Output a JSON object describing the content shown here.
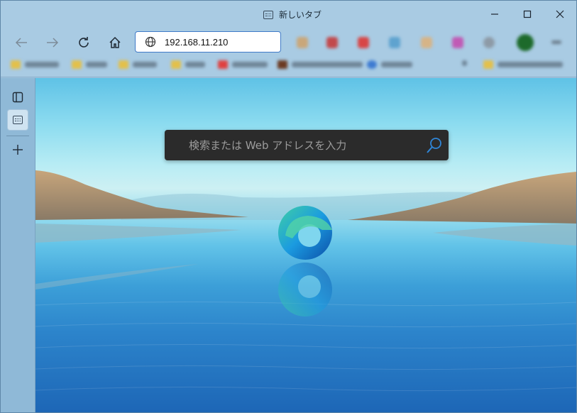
{
  "window": {
    "tab_title": "新しいタブ",
    "tab_icon": "new-tab-icon"
  },
  "toolbar": {
    "address_value": "192.168.11.210",
    "address_icon": "globe-icon"
  },
  "search": {
    "placeholder": "検索または Web アドレスを入力",
    "icon": "search-icon"
  },
  "sidebar": {
    "items": [
      "vertical-tabs-icon",
      "tab-icon",
      "add-icon"
    ]
  },
  "colors": {
    "titlebar": "#a9cbe3",
    "address_border": "#3f7ac7",
    "search_box": "#2b2b2b",
    "sidebar": "#8fb9d7"
  }
}
